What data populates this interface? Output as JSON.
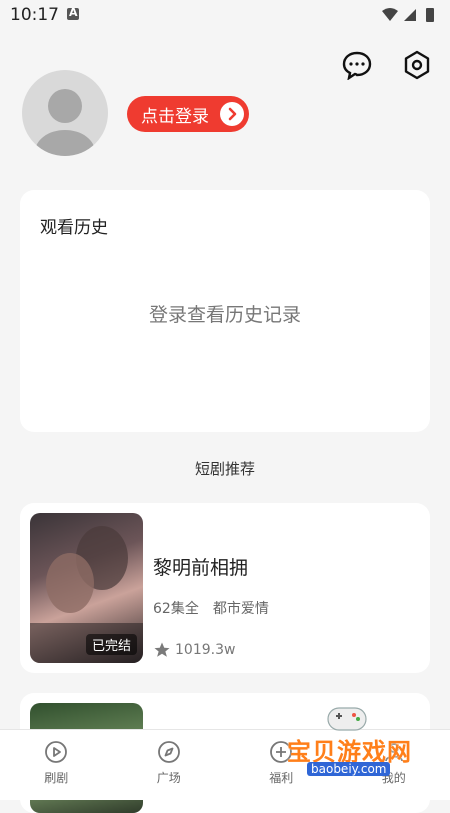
{
  "status_bar": {
    "time": "10:17"
  },
  "profile": {
    "login_label": "点击登录"
  },
  "history": {
    "title": "观看历史",
    "empty_text": "登录查看历史记录"
  },
  "recommend": {
    "section_title": "短剧推荐",
    "items": [
      {
        "title": "黎明前相拥",
        "episodes": "62集全",
        "genre": "都市爱情",
        "views": "1019.3w",
        "badge": "已完结"
      }
    ]
  },
  "bottom_nav": [
    {
      "label": "刷剧",
      "icon": "play-circle-icon"
    },
    {
      "label": "广场",
      "icon": "compass-icon"
    },
    {
      "label": "福利",
      "icon": "gift-icon"
    },
    {
      "label": "我的",
      "icon": "user-icon"
    }
  ],
  "watermark": {
    "text": "宝贝游戏网",
    "url": "baobeiy.com"
  },
  "colors": {
    "accent": "#ef3b30",
    "background": "#f5f5f5",
    "card": "#ffffff"
  }
}
